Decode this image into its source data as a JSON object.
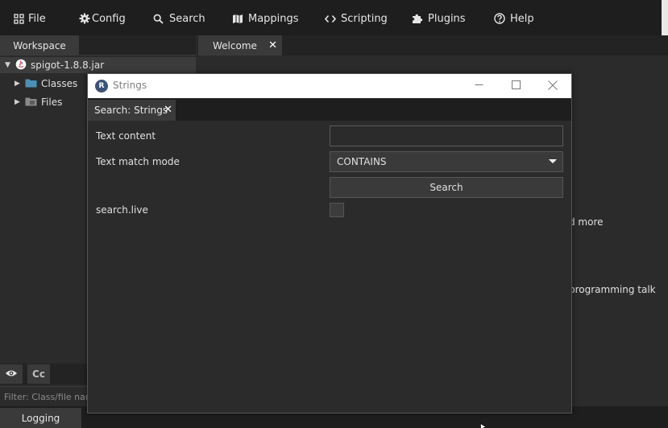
{
  "menu": {
    "items": [
      {
        "label": "File",
        "icon": "grid-icon"
      },
      {
        "label": "Config",
        "icon": "gear-icon"
      },
      {
        "label": "Search",
        "icon": "search-icon"
      },
      {
        "label": "Mappings",
        "icon": "map-icon"
      },
      {
        "label": "Scripting",
        "icon": "code-icon"
      },
      {
        "label": "Plugins",
        "icon": "puzzle-icon"
      },
      {
        "label": "Help",
        "icon": "help-icon"
      }
    ]
  },
  "workspace": {
    "tab_label": "Workspace",
    "tree": {
      "root": "spigot-1.8.8.jar",
      "children": [
        "Classes",
        "Files"
      ]
    },
    "tools": {
      "visibility_icon": "eye-icon",
      "case_label": "Cc"
    },
    "filter_placeholder": "Filter: Class/file name"
  },
  "editor": {
    "tab_label": "Welcome",
    "partial_text": [
      "d more",
      "programming talk"
    ]
  },
  "logging": {
    "tab_label": "Logging"
  },
  "dialog": {
    "title": "Strings",
    "tab_label": "Search: Strings",
    "form": {
      "text_content_label": "Text content",
      "text_content_value": "",
      "match_mode_label": "Text match mode",
      "match_mode_value": "CONTAINS",
      "search_button_label": "Search",
      "live_label": "search.live",
      "live_checked": false
    }
  },
  "colors": {
    "background": "#2b2b2b",
    "menubar": "#1e1e1e",
    "tab_active": "#3a3a3a",
    "accent_folder": "#4a90b8"
  }
}
